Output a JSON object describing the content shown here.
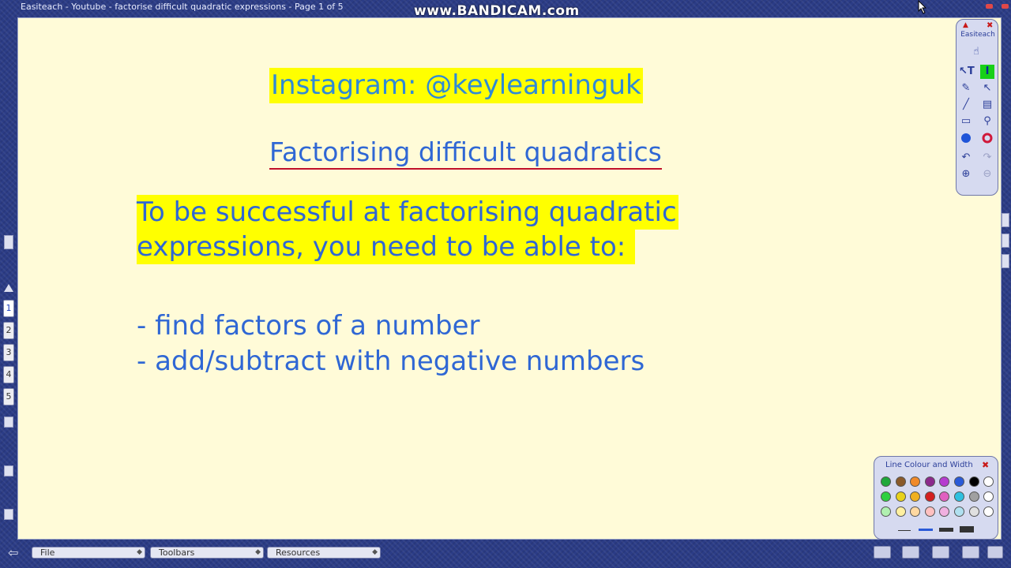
{
  "window": {
    "title": "Easiteach - Youtube - factorise difficult quadratic expressions - Page 1 of 5",
    "watermark": "www.BANDICAM.com"
  },
  "slide": {
    "instagram": "Instagram: @keylearninguk",
    "heading": "Factorising difficult quadratics",
    "intro_lines": [
      "To be successful at factorising quadratic",
      "expressions, you need to be able to:"
    ],
    "bullets": [
      "- find factors of a number",
      "- add/subtract with negative numbers"
    ],
    "highlight_color": "#ffff00",
    "text_color": "#2f67d4",
    "underline_color": "#c0102a"
  },
  "pages": [
    "1",
    "2",
    "3",
    "4",
    "5"
  ],
  "current_page": "1",
  "toolbox": {
    "title": "Easiteach",
    "tools": [
      "hand-icon",
      "select-text-icon",
      "text-tool-icon",
      "pen-icon",
      "pointer-icon",
      "line-icon",
      "stamp-icon",
      "rectangle-icon",
      "fill-icon",
      "blue-dot-icon",
      "red-ring-icon",
      "undo-icon",
      "redo-icon",
      "zoom-in-icon",
      "zoom-out-icon"
    ]
  },
  "palette": {
    "title": "Line Colour and Width",
    "colors_row1": [
      "#1fa83a",
      "#8a5a2b",
      "#f08a2a",
      "#8c2a8c",
      "#b63cd0",
      "#2a5ad8",
      "#000000",
      "#ffffff"
    ],
    "colors_row2": [
      "#2fd040",
      "#e8d21a",
      "#f0b020",
      "#d42020",
      "#e060c0",
      "#30c0e0",
      "#a0a0a0",
      "#ffffff"
    ],
    "colors_row3": [
      "#b0f0b0",
      "#fff0a0",
      "#ffd8a0",
      "#ffc0c0",
      "#f0b0e0",
      "#b0e0f0",
      "#e0e0e0",
      "#ffffff"
    ]
  },
  "bottom": {
    "menus": [
      "File",
      "Toolbars",
      "Resources"
    ]
  }
}
